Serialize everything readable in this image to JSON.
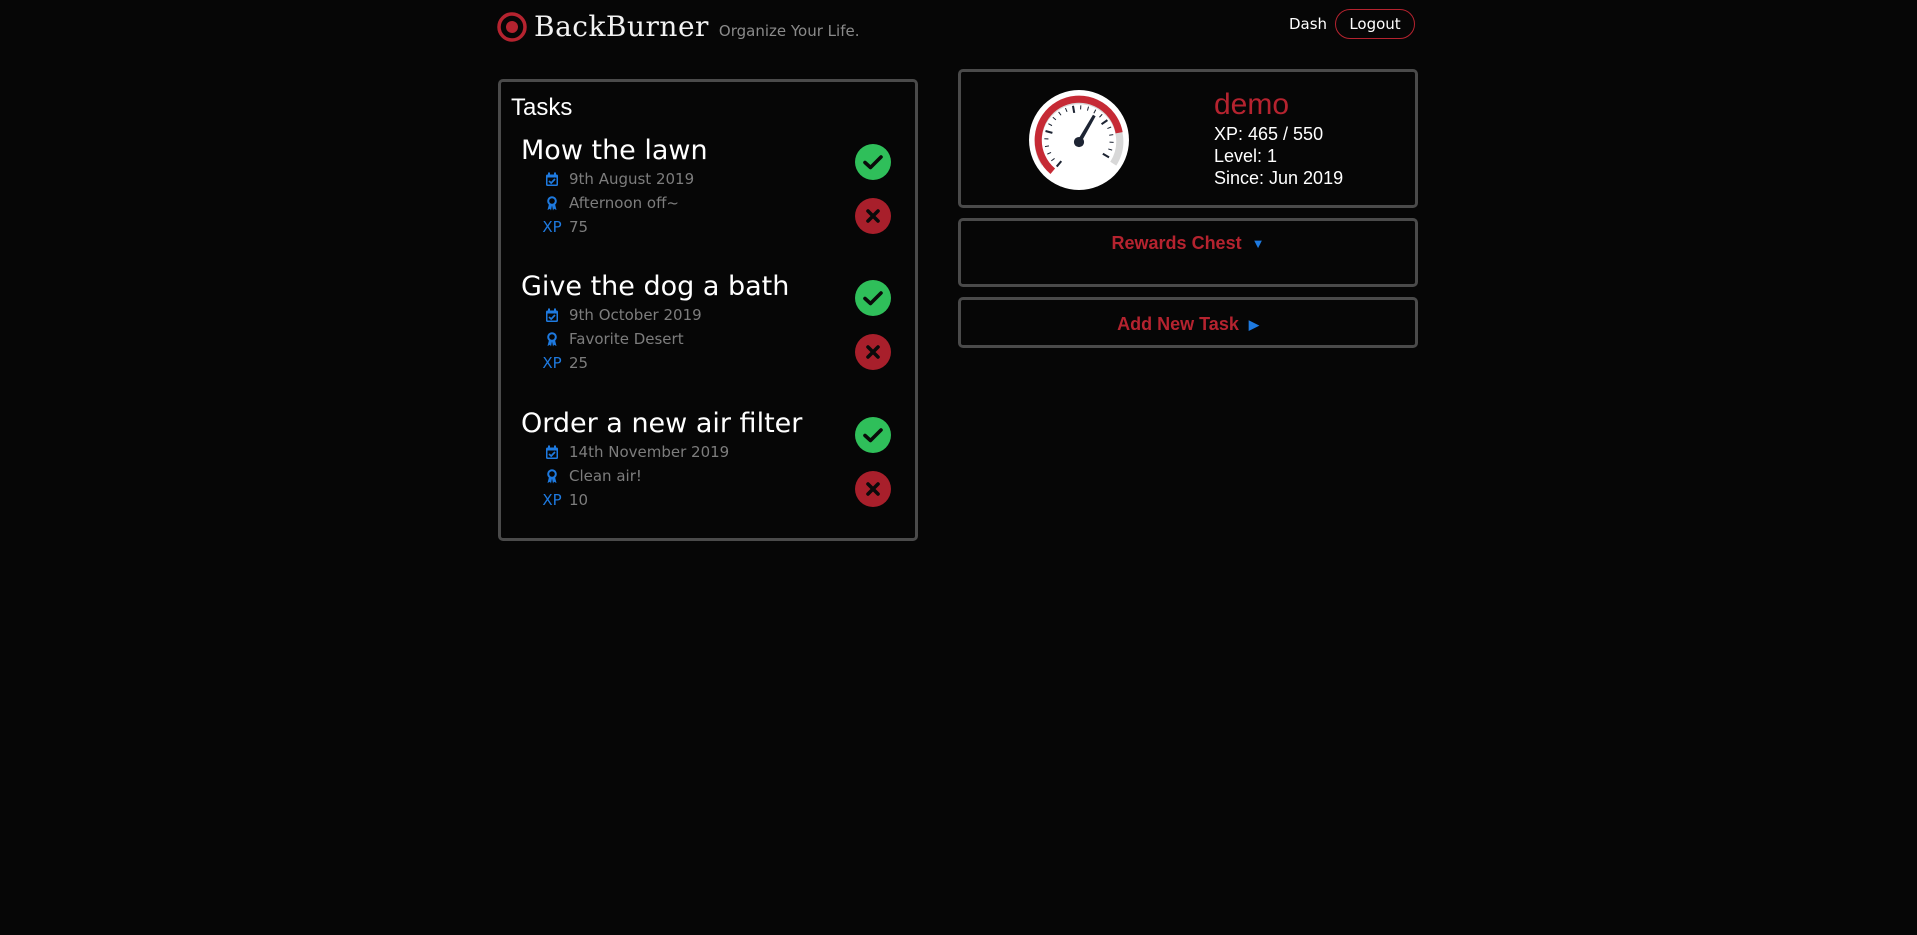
{
  "header": {
    "brand_name": "BackBurner",
    "tagline": "Organize Your Life.",
    "nav_dash": "Dash",
    "nav_logout": "Logout"
  },
  "tasks": {
    "title": "Tasks",
    "items": [
      {
        "title": "Mow the lawn",
        "date": "9th August 2019",
        "reward": "Afternoon off~",
        "xp_label": "XP",
        "xp": "75"
      },
      {
        "title": "Give the dog a bath",
        "date": "9th October 2019",
        "reward": "Favorite Desert",
        "xp_label": "XP",
        "xp": "25"
      },
      {
        "title": "Order a new air filter",
        "date": "14th November 2019",
        "reward": "Clean air!",
        "xp_label": "XP",
        "xp": "10"
      }
    ]
  },
  "profile": {
    "username": "demo",
    "xp": "XP: 465 / 550",
    "level": "Level: 1",
    "since": "Since: Jun 2019",
    "xp_progress": 0.845
  },
  "rewards_chest": {
    "label": "Rewards Chest"
  },
  "add_task": {
    "label": "Add New Task"
  },
  "colors": {
    "accent_red": "#b5232f",
    "accent_blue": "#1e7ae0",
    "complete_green": "#2fbf5a",
    "background": "#060606",
    "panel_border": "#4a4a4a"
  },
  "icons": {
    "logo": "target-icon",
    "date": "calendar-check-icon",
    "reward": "award-ribbon-icon",
    "complete": "check-icon",
    "delete": "x-icon",
    "rewards_caret": "caret-down-icon",
    "add_task_caret": "caret-right-icon",
    "gauge": "speedometer-icon"
  }
}
